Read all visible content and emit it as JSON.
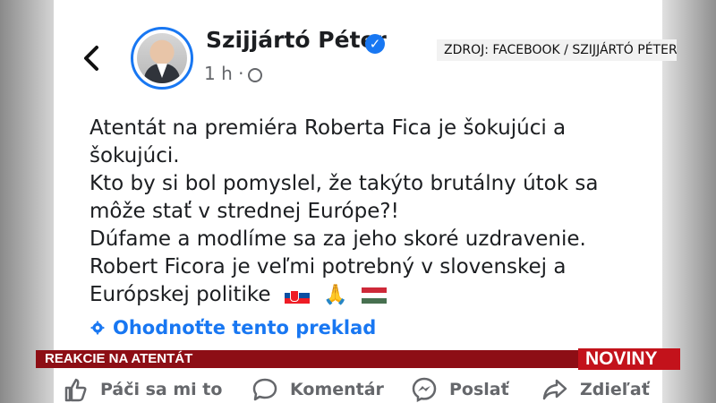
{
  "header": {
    "name": "Szijjártó Péter",
    "meta": "1 h ·",
    "source": "ZDROJ: FACEBOOK / SZIJJÁRTÓ PÉTER"
  },
  "post": {
    "lines": [
      "Atentát na premiéra Roberta Fica je šokujúci a",
      "šokujúci.",
      "Kto by si bol pomyslel, že takýto brutálny útok sa",
      "môže stať v strednej Európe?!",
      "Dúfame a modlíme sa za jeho skoré uzdravenie.",
      "Robert Ficora je veľmi potrebný v slovenskej a",
      "Európskej politike"
    ],
    "emoji": [
      "slovakia-flag",
      "praying-hands",
      "hungary-flag"
    ],
    "translate_label": "Ohodnoťte tento preklad"
  },
  "ticker": {
    "title": "REAKCIE NA ATENTÁT",
    "brand": "NOVINY"
  },
  "actions": {
    "like": "Páči sa mi to",
    "comment": "Komentár",
    "send": "Poslať",
    "share": "Zdieľať"
  },
  "colors": {
    "facebook_blue": "#1877f2",
    "ticker_bg": "#8d0e15",
    "brand_bg": "#c3121b",
    "text": "#1c1e21",
    "muted": "#65676b"
  }
}
